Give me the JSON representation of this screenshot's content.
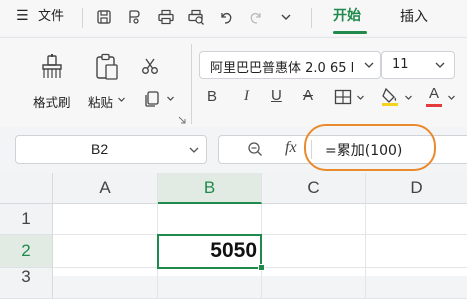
{
  "menu": {
    "hamburger_glyph": "☰",
    "file_label": "文件",
    "tabs": [
      {
        "label": "开始",
        "active": true
      },
      {
        "label": "插入",
        "active": false
      }
    ]
  },
  "ribbon": {
    "format_painter_label": "格式刷",
    "paste_label": "粘贴",
    "font_name": "阿里巴巴普惠体 2.0 65 l",
    "font_size": "11",
    "bold_glyph": "B",
    "italic_glyph": "I",
    "underline_glyph": "U",
    "strike_glyph": "A",
    "font_color_glyph": "A"
  },
  "formula_bar": {
    "cell_ref": "B2",
    "fx_label": "fx",
    "formula": "=累加(100)"
  },
  "grid": {
    "columns": [
      "A",
      "B",
      "C",
      "D"
    ],
    "rows": [
      "1",
      "2",
      "3"
    ],
    "active_cell_value": "5050"
  },
  "colors": {
    "accent_green": "#1f8a4c",
    "highlight_orange": "#e98a2e",
    "font_color_red": "#e23b3b",
    "highlight_yellow": "#f5d31a"
  }
}
